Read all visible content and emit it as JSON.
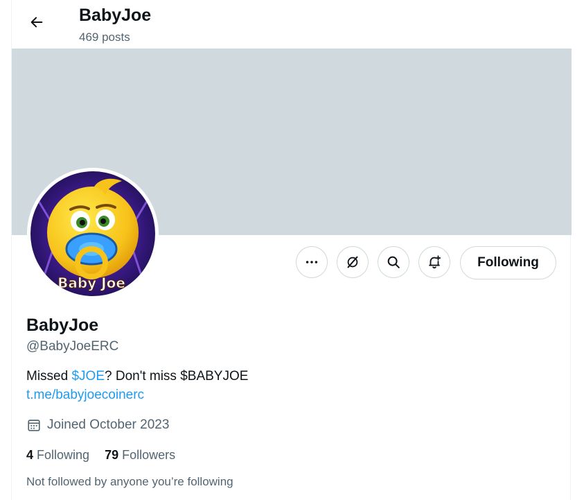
{
  "header": {
    "title": "BabyJoe",
    "posts_count": "469 posts"
  },
  "profile": {
    "display_name": "BabyJoe",
    "handle": "@BabyJoeERC",
    "avatar_text": "Baby Joe",
    "bio": {
      "prefix": "Missed ",
      "cashtag": "$JOE",
      "suffix": "? Don't miss $BABYJOE"
    },
    "website": "t.me/babyjoecoinerc",
    "joined": "Joined October 2023",
    "following_count": "4",
    "following_label": "Following",
    "followers_count": "79",
    "followers_label": "Followers",
    "followed_by_note": "Not followed by anyone you’re following"
  },
  "actions": {
    "more_icon": "more-horizontal-icon",
    "grok_icon": "grok-slash-icon",
    "search_icon": "search-icon",
    "notify_icon": "bell-plus-icon",
    "following_button": "Following"
  },
  "colors": {
    "banner": "#cfd9de",
    "link": "#1d9bf0",
    "secondary_text": "#536471"
  }
}
